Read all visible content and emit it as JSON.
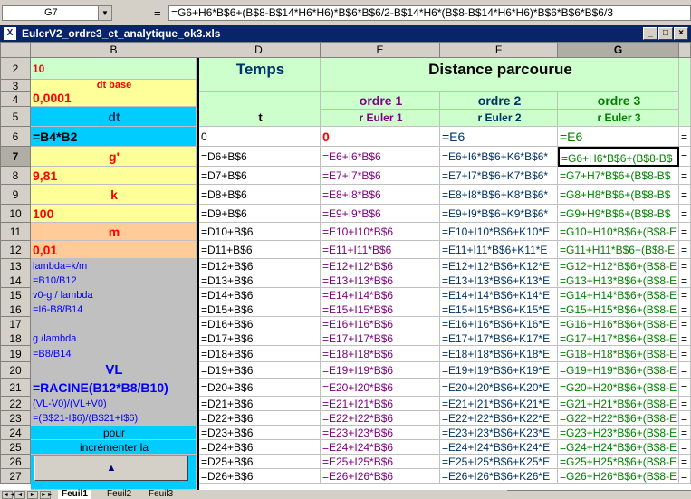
{
  "formula_bar": {
    "cell_ref": "G7",
    "equals": "=",
    "formula": "=G6+H6*B$6+(B$8-B$14*H6*H6)*B$6*B$6/2-B$14*H6*(B$8-B$14*H6*H6)*B$6*B$6*B$6/3"
  },
  "window": {
    "title": "EulerV2_ordre3_et_analytique_ok3.xls",
    "icon": "excel-doc-icon",
    "buttons": [
      "_",
      "□",
      "×"
    ]
  },
  "columns": [
    "B",
    "D",
    "E",
    "F",
    "G"
  ],
  "selected_column": "G",
  "rows": [
    "2",
    "3",
    "4",
    "5",
    "6",
    "7",
    "8",
    "9",
    "10",
    "11",
    "12",
    "13",
    "14",
    "15",
    "16",
    "17",
    "18",
    "19",
    "20",
    "21",
    "22",
    "23",
    "24",
    "25",
    "26",
    "27"
  ],
  "selected_row": "7",
  "colB": {
    "r2": "10",
    "r3": "dt base",
    "r4": "0,0001",
    "r5": "dt",
    "r6": "=B4*B2",
    "r7": "g'",
    "r8": "9,81",
    "r9": "k",
    "r10": "100",
    "r11": "m",
    "r12": "0,01",
    "r13": "lambda=k/m",
    "r14": "=B10/B12",
    "r15": "v0-g / lambda",
    "r16": "=I6-B8/B14",
    "r18": "g /lambda",
    "r19": "=B8/B14",
    "r20": "VL",
    "r21": "=RACINE(B12*B8/B10)",
    "r22": "(VL-V0)/(VL+V0)",
    "r23": "=(B$21-I$6)/(B$21+I$6)",
    "r24": "pour",
    "r25": "incrémenter la",
    "spin_up": "▲"
  },
  "headers": {
    "temps": "Temps",
    "distance": "Distance parcourue",
    "t": "t",
    "ordre1": "ordre 1",
    "ordre2": "ordre 2",
    "ordre3": "ordre 3",
    "euler1": "r Euler 1",
    "euler2": "r Euler 2",
    "euler3": "r Euler 3"
  },
  "row6": {
    "D": "0",
    "E": "0",
    "F": "=E6",
    "G": "=E6",
    "H": "="
  },
  "colD": [
    "=D6+B$6",
    "=D7+B$6",
    "=D8+B$6",
    "=D9+B$6",
    "=D10+B$6",
    "=D11+B$6",
    "=D12+B$6",
    "=D13+B$6",
    "=D14+B$6",
    "=D15+B$6",
    "=D16+B$6",
    "=D17+B$6",
    "=D18+B$6",
    "=D19+B$6",
    "=D20+B$6",
    "=D21+B$6",
    "=D22+B$6",
    "=D23+B$6",
    "=D24+B$6",
    "=D25+B$6",
    "=D26+B$6"
  ],
  "colE": [
    "=E6+I6*B$6",
    "=E7+I7*B$6",
    "=E8+I8*B$6",
    "=E9+I9*B$6",
    "=E10+I10*B$6",
    "=E11+I11*B$6",
    "=E12+I12*B$6",
    "=E13+I13*B$6",
    "=E14+I14*B$6",
    "=E15+I15*B$6",
    "=E16+I16*B$6",
    "=E17+I17*B$6",
    "=E18+I18*B$6",
    "=E19+I19*B$6",
    "=E20+I20*B$6",
    "=E21+I21*B$6",
    "=E22+I22*B$6",
    "=E23+I23*B$6",
    "=E24+I24*B$6",
    "=E25+I25*B$6",
    "=E26+I26*B$6"
  ],
  "colF": [
    "=E6+I6*B$6+K6*B$6*",
    "=E7+I7*B$6+K7*B$6*",
    "=E8+I8*B$6+K8*B$6*",
    "=E9+I9*B$6+K9*B$6*",
    "=E10+I10*B$6+K10*E",
    "=E11+I11*B$6+K11*E",
    "=E12+I12*B$6+K12*E",
    "=E13+I13*B$6+K13*E",
    "=E14+I14*B$6+K14*E",
    "=E15+I15*B$6+K15*E",
    "=E16+I16*B$6+K16*E",
    "=E17+I17*B$6+K17*E",
    "=E18+I18*B$6+K18*E",
    "=E19+I19*B$6+K19*E",
    "=E20+I20*B$6+K20*E",
    "=E21+I21*B$6+K21*E",
    "=E22+I22*B$6+K22*E",
    "=E23+I23*B$6+K23*E",
    "=E24+I24*B$6+K24*E",
    "=E25+I25*B$6+K25*E",
    "=E26+I26*B$6+K26*E"
  ],
  "colG": [
    "=G6+H6*B$6+(B$8-B$",
    "=G7+H7*B$6+(B$8-B$",
    "=G8+H8*B$6+(B$8-B$",
    "=G9+H9*B$6+(B$8-B$",
    "=G10+H10*B$6+(B$8-E",
    "=G11+H11*B$6+(B$8-E",
    "=G12+H12*B$6+(B$8-E",
    "=G13+H13*B$6+(B$8-E",
    "=G14+H14*B$6+(B$8-E",
    "=G15+H15*B$6+(B$8-E",
    "=G16+H16*B$6+(B$8-E",
    "=G17+H17*B$6+(B$8-E",
    "=G18+H18*B$6+(B$8-E",
    "=G19+H19*B$6+(B$8-E",
    "=G20+H20*B$6+(B$8-E",
    "=G21+H21*B$6+(B$8-E",
    "=G22+H22*B$6+(B$8-E",
    "=G23+H23*B$6+(B$8-E",
    "=G24+H24*B$6+(B$8-E",
    "=G25+H25*B$6+(B$8-E",
    "=G26+H26*B$6+(B$8-E"
  ],
  "colH_partial": "=",
  "sheet_tabs": [
    "Feuil1",
    "Feuil2",
    "Feuil3"
  ],
  "active_tab": "Feuil1",
  "nav_buttons": [
    "◄◄",
    "◄",
    "►",
    "►►"
  ],
  "colors": {
    "green_bg": "#ccffcc",
    "yellow_bg": "#ffff99",
    "cyan_bg": "#00ccff",
    "orange_bg": "#ffcc99",
    "gray_bg": "#c0c0c0",
    "red_text": "#ff0000",
    "navy_text": "#003366",
    "purple_text": "#800080",
    "green_text": "#008000",
    "blue_text": "#0000ff"
  }
}
